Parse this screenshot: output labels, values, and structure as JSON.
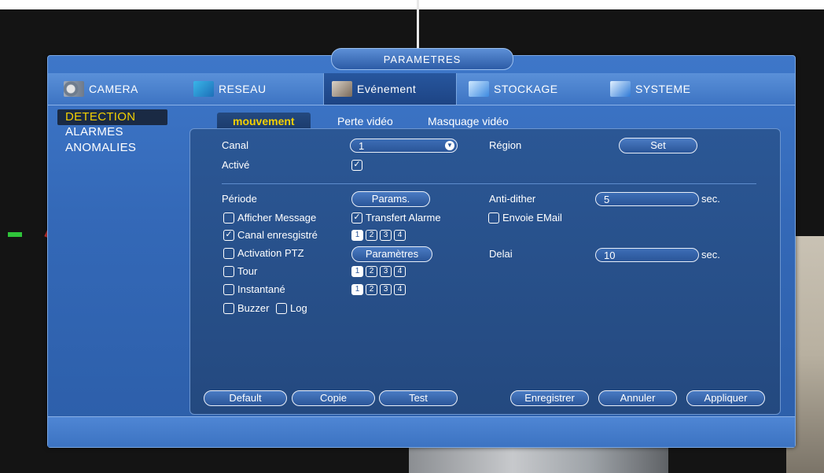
{
  "window": {
    "title": "PARAMETRES"
  },
  "tabs": [
    {
      "label": "CAMERA",
      "icon": "camera-icon"
    },
    {
      "label": "RESEAU",
      "icon": "network-icon"
    },
    {
      "label": "Evénement",
      "icon": "event-icon",
      "active": true
    },
    {
      "label": "STOCKAGE",
      "icon": "storage-icon"
    },
    {
      "label": "SYSTEME",
      "icon": "system-icon"
    }
  ],
  "sidebar": {
    "items": [
      {
        "label": "DETECTION",
        "active": true
      },
      {
        "label": "ALARMES"
      },
      {
        "label": "ANOMALIES"
      }
    ]
  },
  "subtabs": [
    {
      "label": "mouvement",
      "active": true
    },
    {
      "label": "Perte vidéo"
    },
    {
      "label": "Masquage vidéo"
    }
  ],
  "form": {
    "canal_label": "Canal",
    "canal_value": "1",
    "region_label": "Région",
    "region_button": "Set",
    "active_label": "Activé",
    "active_checked": true,
    "periode_label": "Période",
    "periode_button": "Params.",
    "antidither_label": "Anti-dither",
    "antidither_value": "5",
    "antidither_unit": "sec.",
    "afficher_message": {
      "label": "Afficher Message",
      "checked": false
    },
    "transfert_alarme": {
      "label": "Transfert Alarme",
      "checked": true
    },
    "envoie_email": {
      "label": "Envoie EMail",
      "checked": false
    },
    "canal_enregistre": {
      "label": "Canal enresgistré",
      "checked": true,
      "channels": [
        "1",
        "2",
        "3",
        "4"
      ],
      "selected": [
        "1"
      ]
    },
    "activation_ptz": {
      "label": "Activation PTZ",
      "checked": false,
      "button": "Paramètres"
    },
    "delai_label": "Delai",
    "delai_value": "10",
    "delai_unit": "sec.",
    "tour": {
      "label": "Tour",
      "checked": false,
      "channels": [
        "1",
        "2",
        "3",
        "4"
      ],
      "selected": [
        "1"
      ]
    },
    "instantane": {
      "label": "Instantané",
      "checked": false,
      "channels": [
        "1",
        "2",
        "3",
        "4"
      ],
      "selected": [
        "1"
      ]
    },
    "buzzer": {
      "label": "Buzzer",
      "checked": false
    },
    "log": {
      "label": "Log",
      "checked": false
    }
  },
  "buttons": {
    "default": "Default",
    "copie": "Copie",
    "test": "Test",
    "enregistrer": "Enregistrer",
    "annuler": "Annuler",
    "appliquer": "Appliquer"
  },
  "colors": {
    "accent_yellow": "#f4d000",
    "panel_blue": "#2b5795",
    "frame_blue": "#3e77c9"
  }
}
